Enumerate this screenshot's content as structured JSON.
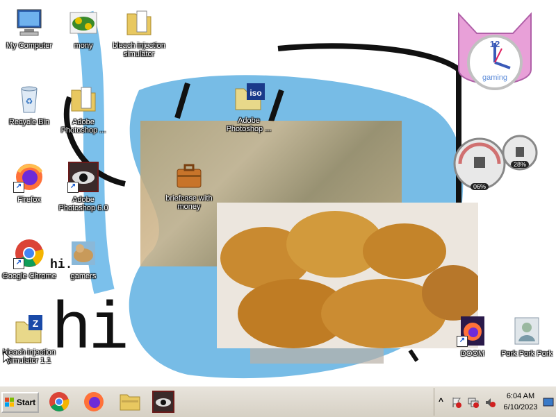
{
  "desktop": {
    "icons": [
      {
        "label": "My Computer",
        "icon": "computer-icon"
      },
      {
        "label": "mony",
        "icon": "money-icon"
      },
      {
        "label": "bleach injection simulator",
        "icon": "folder-icon"
      },
      {
        "label": "Recycle Bin",
        "icon": "recycle-bin-icon"
      },
      {
        "label": "Adobe Photoshop ...",
        "icon": "folder-icon"
      },
      {
        "label": "Adobe Photoshop ...",
        "icon": "iso-file-icon"
      },
      {
        "label": "Firefox",
        "icon": "firefox-icon"
      },
      {
        "label": "Adobe Photoshop 6.0",
        "icon": "photoshop-eye-icon"
      },
      {
        "label": "briefcase with money",
        "icon": "briefcase-icon"
      },
      {
        "label": "Google Chrome",
        "icon": "chrome-icon"
      },
      {
        "label": "gamers",
        "icon": "gamers-icon"
      },
      {
        "label": "bleach injection simulator 1.1",
        "icon": "zip-file-icon"
      },
      {
        "label": "DOOM",
        "icon": "doom-firefox-icon"
      },
      {
        "label": "Pork Pork Pork",
        "icon": "contact-icon"
      }
    ],
    "scribbles": {
      "big_hi": "hi",
      "small_hi": "hi."
    },
    "clock_gadget": {
      "label": "gaming",
      "hour_text": "12"
    },
    "meter_gadget": {
      "cpu": "06%",
      "memory": "28%"
    }
  },
  "taskbar": {
    "start_label": "Start",
    "pinned": [
      "chrome-icon",
      "firefox-icon",
      "folder-icon",
      "photoshop-eye-icon"
    ],
    "tray": {
      "expand_glyph": "^",
      "time": "6:04 AM",
      "date": "6/10/2023"
    }
  },
  "colors": {
    "taskbar": "#d6d0c4",
    "scribble_blue": "#3aa0e0",
    "nugget": "#c8862c"
  }
}
